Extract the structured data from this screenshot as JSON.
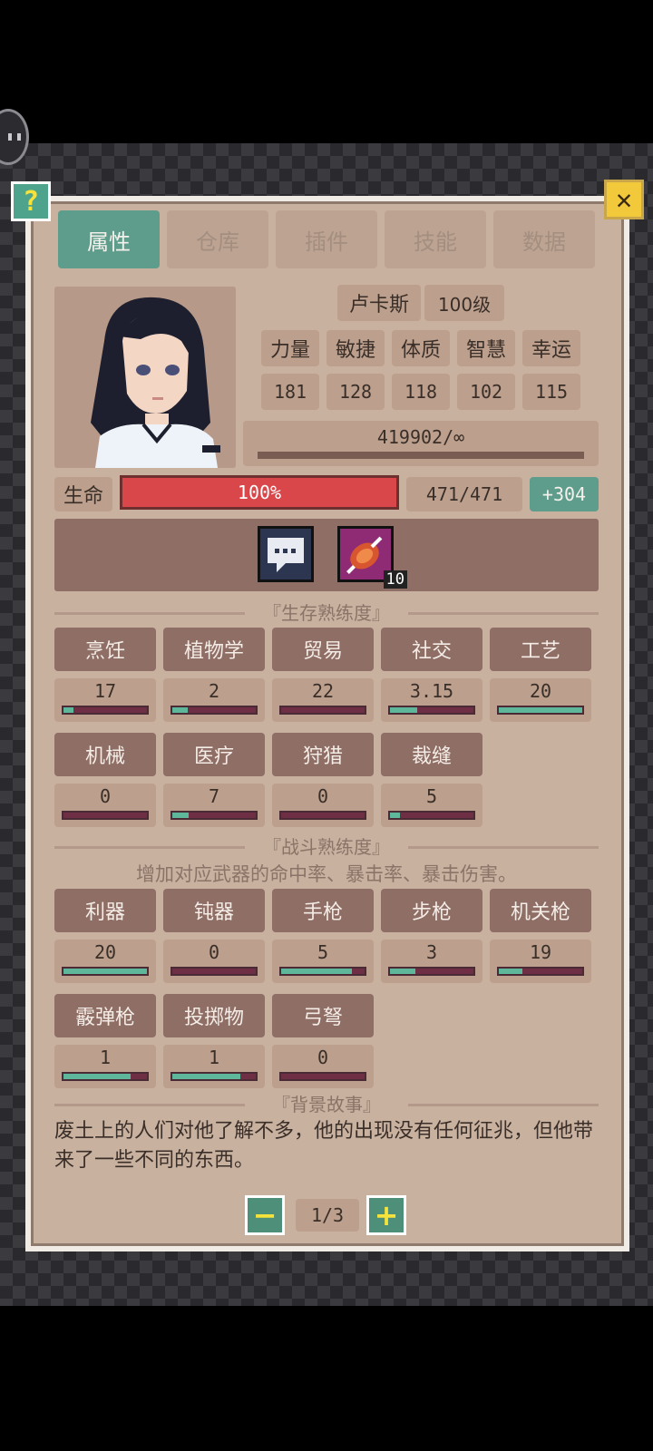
{
  "tabs": [
    {
      "label": "属性",
      "active": true
    },
    {
      "label": "仓库",
      "active": false
    },
    {
      "label": "插件",
      "active": false
    },
    {
      "label": "技能",
      "active": false
    },
    {
      "label": "数据",
      "active": false
    }
  ],
  "header": {
    "help_label": "?",
    "close_label": "✕"
  },
  "character": {
    "name": "卢卡斯",
    "level": "100级",
    "attributes": [
      {
        "name": "力量",
        "value": "181"
      },
      {
        "name": "敏捷",
        "value": "128"
      },
      {
        "name": "体质",
        "value": "118"
      },
      {
        "name": "智慧",
        "value": "102"
      },
      {
        "name": "幸运",
        "value": "115"
      }
    ],
    "xp": "419902/∞",
    "hp_label": "生命",
    "hp_percent_text": "100%",
    "hp_fraction": 1.0,
    "hp_value": "471/471",
    "hp_bonus": "+304"
  },
  "items": [
    {
      "icon": "chat-bubble-icon"
    },
    {
      "icon": "meat-icon",
      "count": "10"
    }
  ],
  "survival": {
    "title": "『生存熟练度』",
    "skills": [
      {
        "name": "烹饪",
        "value": "17",
        "progress": 0.12
      },
      {
        "name": "植物学",
        "value": "2",
        "progress": 0.18
      },
      {
        "name": "贸易",
        "value": "22",
        "progress": 0.0
      },
      {
        "name": "社交",
        "value": "3.15",
        "progress": 0.33
      },
      {
        "name": "工艺",
        "value": "20",
        "progress": 1.0
      },
      {
        "name": "机械",
        "value": "0",
        "progress": 0.0
      },
      {
        "name": "医疗",
        "value": "7",
        "progress": 0.2
      },
      {
        "name": "狩猎",
        "value": "0",
        "progress": 0.0
      },
      {
        "name": "裁缝",
        "value": "5",
        "progress": 0.12
      }
    ]
  },
  "combat": {
    "title": "『战斗熟练度』",
    "desc": "增加对应武器的命中率、暴击率、暴击伤害。",
    "skills": [
      {
        "name": "利器",
        "value": "20",
        "progress": 1.0
      },
      {
        "name": "钝器",
        "value": "0",
        "progress": 0.0
      },
      {
        "name": "手枪",
        "value": "5",
        "progress": 0.85
      },
      {
        "name": "步枪",
        "value": "3",
        "progress": 0.3
      },
      {
        "name": "机关枪",
        "value": "19",
        "progress": 0.28
      },
      {
        "name": "霰弹枪",
        "value": "1",
        "progress": 0.8
      },
      {
        "name": "投掷物",
        "value": "1",
        "progress": 0.82
      },
      {
        "name": "弓弩",
        "value": "0",
        "progress": 0.0
      }
    ]
  },
  "story": {
    "title": "『背景故事』",
    "text": "废土上的人们对他了解不多，他的出现没有任何征兆，但他带来了一些不同的东西。"
  },
  "pager": {
    "text": "1/3",
    "minus": "−",
    "plus": "+"
  }
}
